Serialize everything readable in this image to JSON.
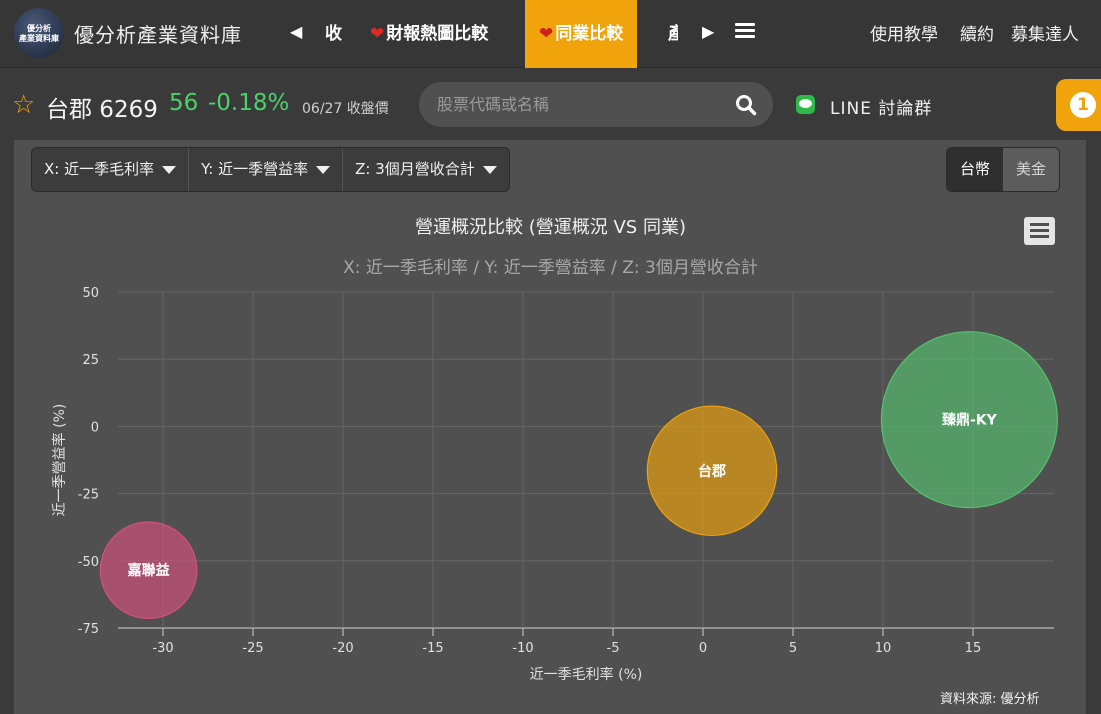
{
  "nav": {
    "logo_line1": "優分析",
    "logo_line2": "產業資料庫",
    "site_title": "優分析產業資料庫",
    "items": [
      {
        "label": "收",
        "heart": false,
        "active": false
      },
      {
        "label": "財報熱圖比較",
        "heart": true,
        "active": false
      },
      {
        "label": "同業比較",
        "heart": true,
        "active": true
      },
      {
        "label": "產",
        "heart": false,
        "active": false
      }
    ],
    "right_links": [
      "使用教學",
      "續約",
      "募集達人"
    ]
  },
  "stock": {
    "name": "台郡 6269",
    "price": "56",
    "change": "-0.18%",
    "date_label": "06/27 收盤價"
  },
  "search": {
    "placeholder": "股票代碼或名稱"
  },
  "line_group": "LINE 討論群",
  "notification_count": "1",
  "controls": {
    "x_select": "X: 近一季毛利率",
    "y_select": "Y: 近一季營益率",
    "z_select": "Z: 3個月營收合計",
    "currency_options": [
      "台幣",
      "美金"
    ],
    "currency_selected": "台幣"
  },
  "chart_data": {
    "type": "bubble",
    "title": "營運概況比較 (營運概況 VS 同業)",
    "subtitle": "X: 近一季毛利率 / Y: 近一季營益率 / Z: 3個月營收合計",
    "xlabel": "近一季毛利率 (%)",
    "ylabel": "近一季營益率 (%)",
    "xlim": [
      -32.5,
      19.5
    ],
    "ylim": [
      -75,
      50
    ],
    "xticks": [
      -30,
      -25,
      -20,
      -15,
      -10,
      -5,
      0,
      5,
      10,
      15
    ],
    "yticks": [
      50,
      25,
      0,
      -25,
      -50,
      -75
    ],
    "grid": true,
    "points": [
      {
        "name": "嘉聯益",
        "x": -30.8,
        "y": -53.5,
        "z": 30,
        "color": "#d6507c"
      },
      {
        "name": "台郡",
        "x": 0.5,
        "y": -16.5,
        "z": 54,
        "color": "#f0a30a"
      },
      {
        "name": "臻鼎-KY",
        "x": 14.8,
        "y": 2.5,
        "z": 100,
        "color": "#56c26f"
      }
    ],
    "source": "資料來源: 優分析"
  }
}
